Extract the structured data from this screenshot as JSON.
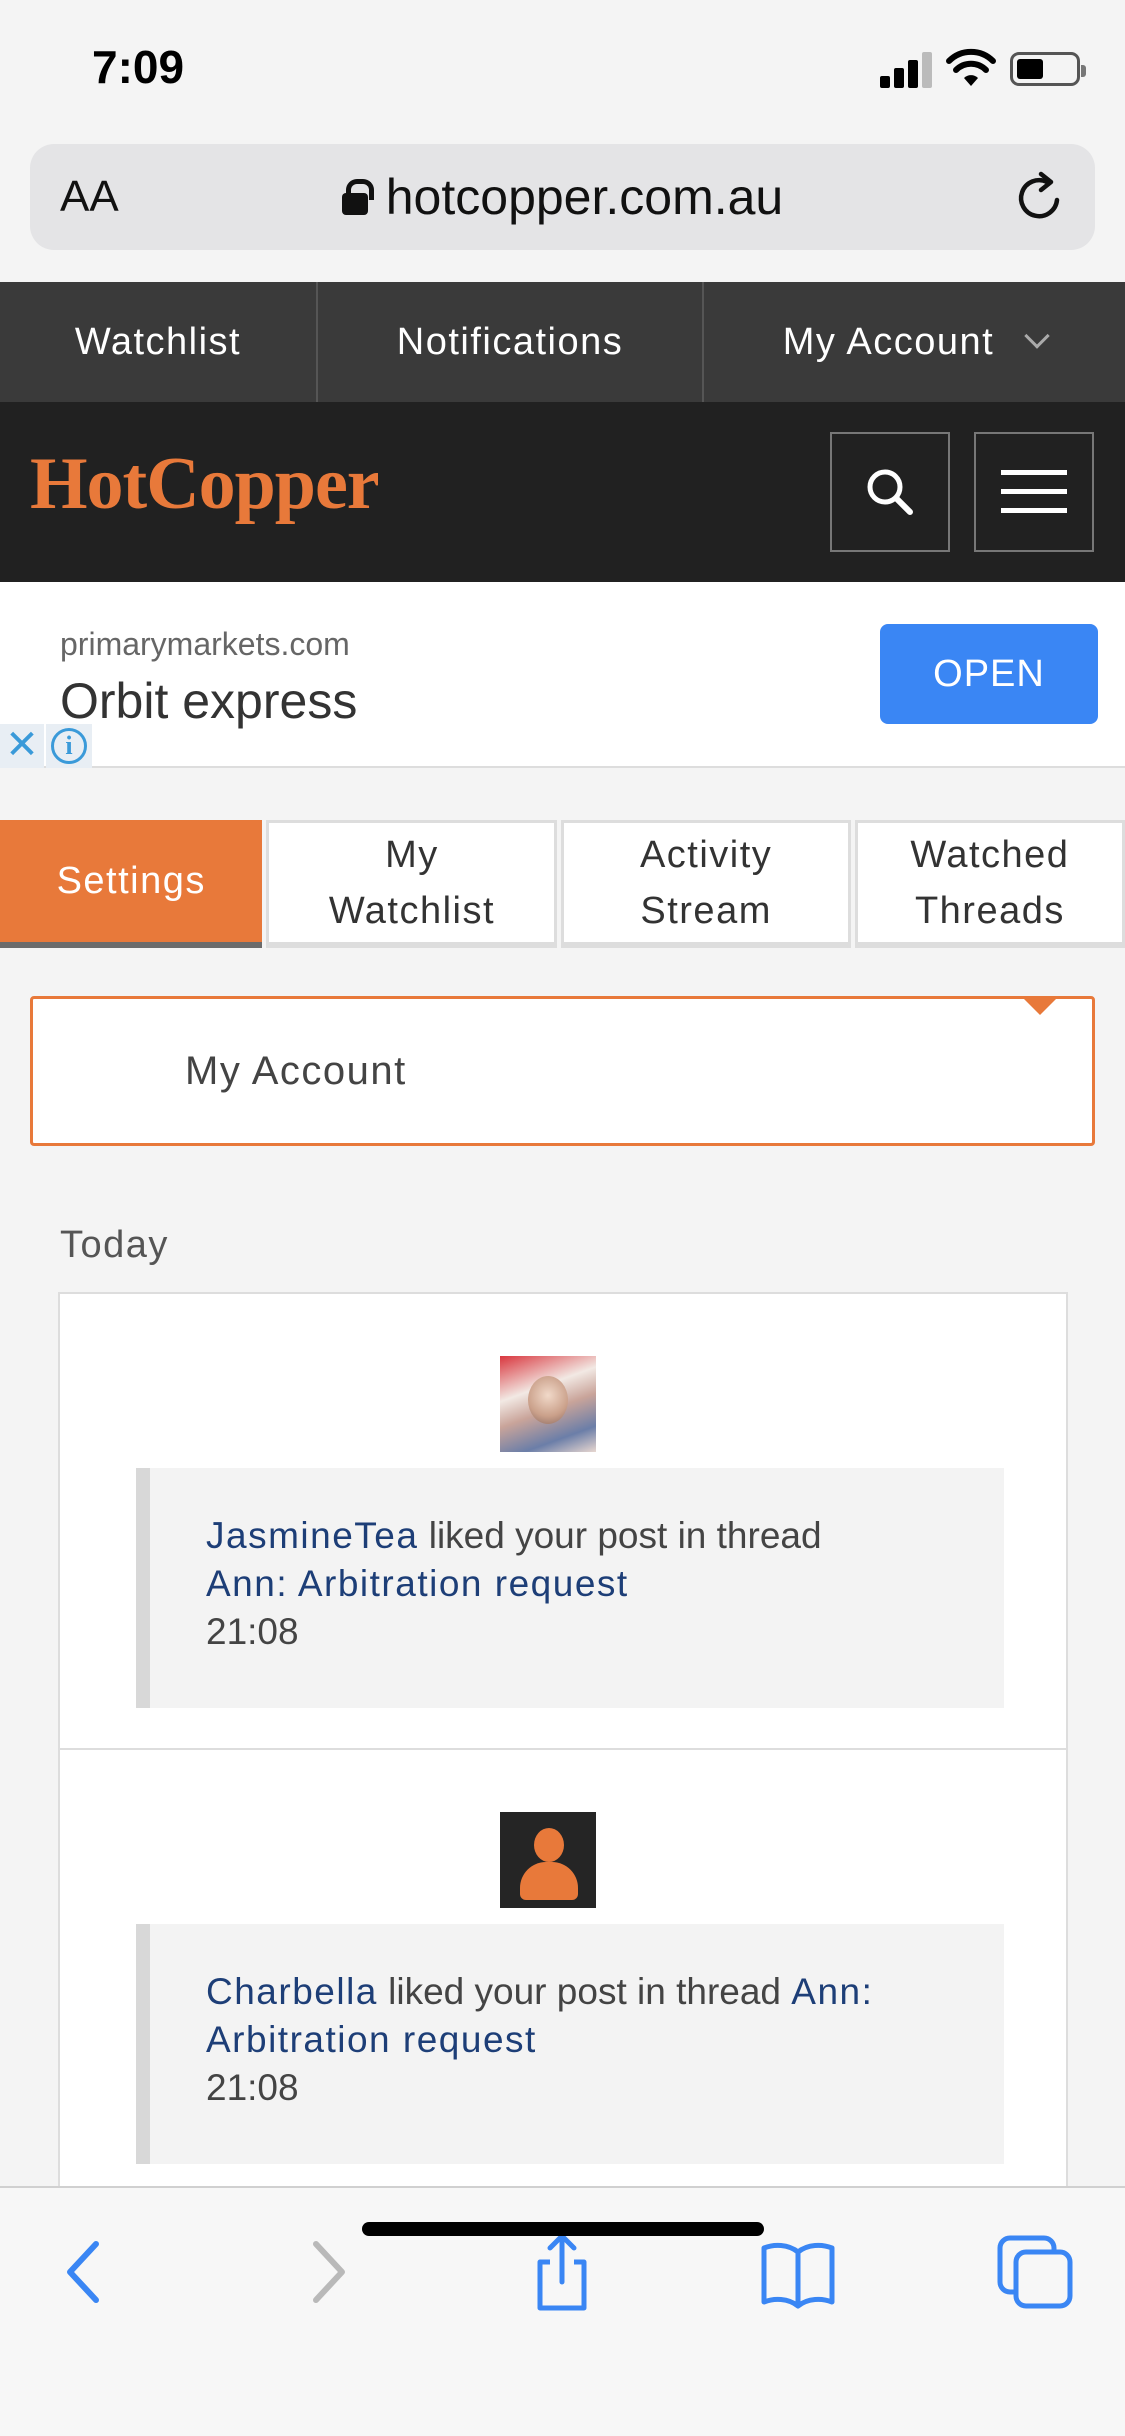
{
  "status_bar": {
    "time": "7:09"
  },
  "browser": {
    "text_size_label": "AA",
    "url": "hotcopper.com.au"
  },
  "top_nav": {
    "items": [
      {
        "label": "Watchlist"
      },
      {
        "label": "Notifications"
      },
      {
        "label": "My Account"
      }
    ]
  },
  "brand": {
    "logo": "HotCopper"
  },
  "ad": {
    "domain": "primarymarkets.com",
    "title": "Orbit express",
    "cta": "OPEN",
    "close_glyph": "✕",
    "info_glyph": "i"
  },
  "tabs": [
    {
      "label": "Settings",
      "active": true
    },
    {
      "label": "My Watchlist",
      "active": false
    },
    {
      "label": "Activity Stream",
      "active": false
    },
    {
      "label": "Watched Threads",
      "active": false
    }
  ],
  "account_dropdown": {
    "selected": "My Account"
  },
  "feed": {
    "section": "Today",
    "items": [
      {
        "user": "JasmineTea",
        "action": "liked your post in thread",
        "thread": "Ann: Arbitration request",
        "time": "21:08",
        "avatar": "photo"
      },
      {
        "user": "Charbella",
        "action": "liked your post in thread",
        "thread": "Ann: Arbitration request",
        "time": "21:08",
        "avatar": "default-user-icon"
      }
    ]
  },
  "colors": {
    "accent": "#e8793a",
    "link": "#1d3e77",
    "nav_dark": "#3a3a3a",
    "brand_dark": "#212121",
    "ios_blue": "#3a86f4"
  }
}
